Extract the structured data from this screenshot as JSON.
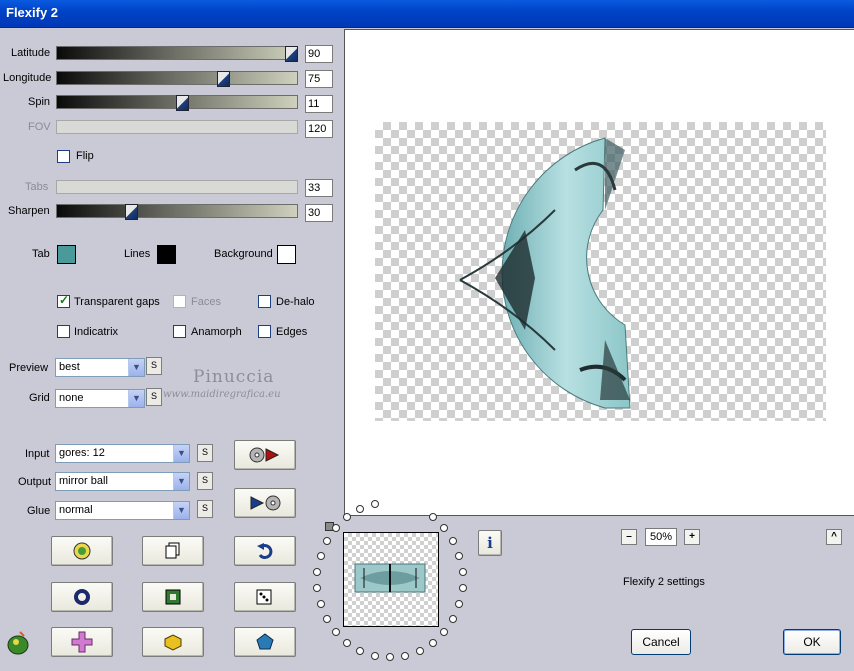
{
  "window": {
    "title": "Flexify 2"
  },
  "sliders": [
    {
      "label": "Latitude",
      "value": "90",
      "level": 1.0,
      "enabled": true
    },
    {
      "label": "Longitude",
      "value": "75",
      "level": 0.7,
      "enabled": true
    },
    {
      "label": "Spin",
      "value": "11",
      "level": 0.52,
      "enabled": true
    },
    {
      "label": "FOV",
      "value": "120",
      "enabled": false
    }
  ],
  "flip": {
    "label": "Flip",
    "checked": false
  },
  "sliders2": [
    {
      "label": "Tabs",
      "value": "33",
      "enabled": false
    },
    {
      "label": "Sharpen",
      "value": "30",
      "level": 0.3,
      "enabled": true
    }
  ],
  "colors": {
    "tab": {
      "label": "Tab",
      "color": "#4a9a9a"
    },
    "lines": {
      "label": "Lines",
      "color": "#000000"
    },
    "background": {
      "label": "Background",
      "color": "#ffffff"
    }
  },
  "checks": {
    "transparent_gaps": {
      "label": "Transparent gaps",
      "checked": true
    },
    "faces": {
      "label": "Faces",
      "checked": false,
      "enabled": false
    },
    "de_halo": {
      "label": "De-halo",
      "checked": false
    },
    "indicatrix": {
      "label": "Indicatrix",
      "checked": false
    },
    "anamorph": {
      "label": "Anamorph",
      "checked": false
    },
    "edges": {
      "label": "Edges",
      "checked": false
    }
  },
  "preview": {
    "label": "Preview",
    "value": "best"
  },
  "grid": {
    "label": "Grid",
    "value": "none"
  },
  "input": {
    "label": "Input",
    "value": "gores: 12"
  },
  "output": {
    "label": "Output",
    "value": "mirror ball"
  },
  "glue": {
    "label": "Glue",
    "value": "normal"
  },
  "s_button": "S",
  "watermark": {
    "name": "Pinuccia",
    "url": "www.maidiregrafica.eu"
  },
  "zoom": {
    "minus": "–",
    "value": "50%",
    "plus": "+"
  },
  "settings_label": "Flexify 2 settings",
  "info_label": "i",
  "up_label": "^",
  "buttons": {
    "cancel": "Cancel",
    "ok": "OK"
  },
  "palette": {
    "accent": "#0a5bdf",
    "panel": "#c9cad6"
  }
}
